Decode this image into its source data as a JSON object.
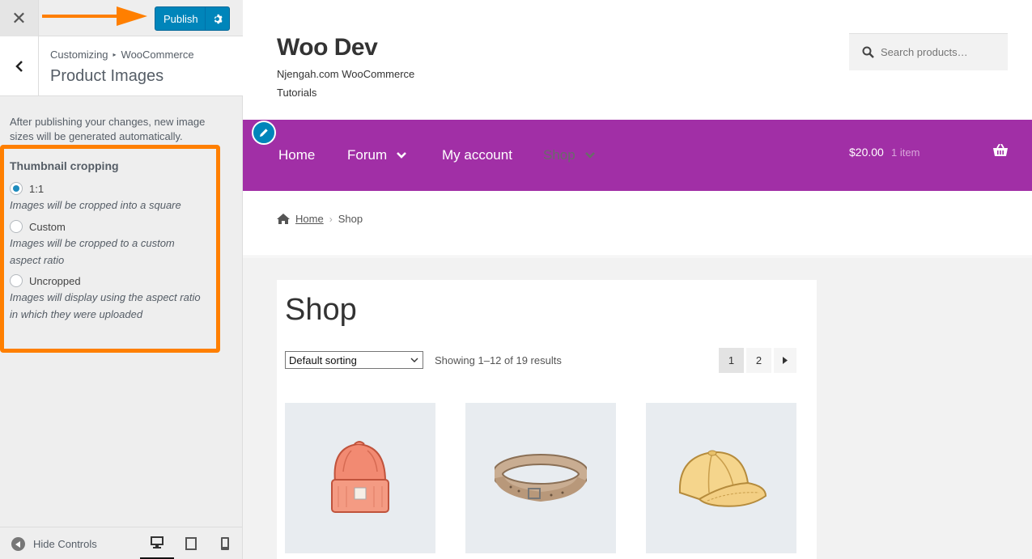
{
  "sidebar": {
    "close_icon": "close-icon",
    "publish_label": "Publish",
    "breadcrumb": {
      "root": "Customizing",
      "section": "WooCommerce"
    },
    "panel_title": "Product Images",
    "description": "After publishing your changes, new image sizes will be generated automatically.",
    "cropping": {
      "title": "Thumbnail cropping",
      "options": [
        {
          "label": "1:1",
          "description": "Images will be cropped into a square",
          "checked": true
        },
        {
          "label": "Custom",
          "description": "Images will be cropped to a custom aspect ratio",
          "checked": false
        },
        {
          "label": "Uncropped",
          "description": "Images will display using the aspect ratio in which they were uploaded",
          "checked": false
        }
      ]
    },
    "footer": {
      "hide_controls": "Hide Controls",
      "devices": [
        "desktop",
        "tablet",
        "mobile"
      ],
      "active_device": "desktop"
    }
  },
  "site": {
    "title": "Woo Dev",
    "description": "Njengah.com WooCommerce Tutorials",
    "search_placeholder": "Search products…",
    "nav": [
      {
        "label": "Home"
      },
      {
        "label": "Forum",
        "has_dropdown": true
      },
      {
        "label": "My account"
      },
      {
        "label": "Shop",
        "has_dropdown": true,
        "current": true
      }
    ],
    "cart": {
      "amount": "$20.00",
      "items": "1 item"
    },
    "breadcrumb": {
      "home": "Home",
      "current": "Shop"
    },
    "shop": {
      "title": "Shop",
      "sort_value": "Default sorting",
      "result_count": "Showing 1–12 of 19 results",
      "pages": [
        "1",
        "2"
      ],
      "current_page": "1"
    },
    "products": [
      "beanie",
      "belt",
      "cap"
    ]
  },
  "colors": {
    "accent": "#0085ba",
    "nav_bg": "#a12fa6",
    "highlight": "#ff7f00"
  }
}
